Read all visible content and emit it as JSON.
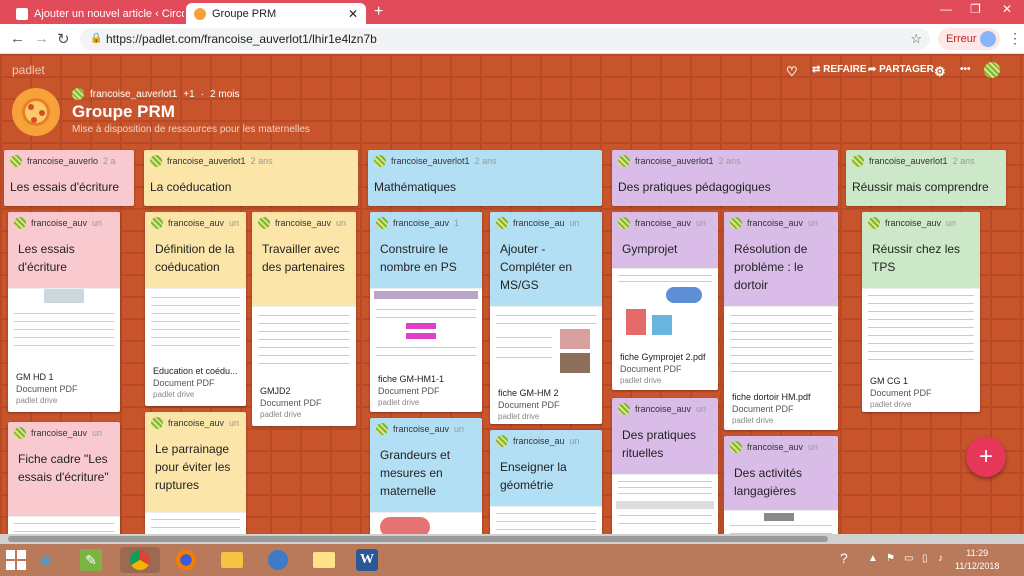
{
  "browser": {
    "tabs": [
      {
        "title": "Ajouter un nouvel article ‹ Circon",
        "active": false
      },
      {
        "title": "Groupe PRM",
        "active": true
      }
    ],
    "new_tab": "+",
    "url": "https://padlet.com/francoise_auverlot1/lhir1e4lzn7b",
    "error_label": "Erreur",
    "window_controls": {
      "minimize": "—",
      "restore": "❐",
      "close": "✕"
    }
  },
  "padlet": {
    "logo": "padlet",
    "actions": {
      "remake": "REFAIRE",
      "share": "PARTAGER"
    },
    "icons": [
      "heart-icon",
      "remake-icon",
      "share-icon",
      "settings-icon",
      "more-icon"
    ],
    "author": "francoise_auverlot1",
    "plus": "+1",
    "dot": "·",
    "age": "2 mois",
    "title": "Groupe PRM",
    "subtitle": "Mise à disposition de ressources pour les maternelles"
  },
  "columns": [
    {
      "author": "francoise_auverlo",
      "ago": "2 a",
      "title": "Les essais d'écriture",
      "color": "#f8c9cf"
    },
    {
      "author": "francoise_auverlot1",
      "ago": "2 ans",
      "title": "La coéducation",
      "color": "#fbe5a8"
    },
    {
      "author": "francoise_auverlot1",
      "ago": "2 ans",
      "title": "Mathématiques",
      "color": "#b3dff5"
    },
    {
      "author": "francoise_auverlot1",
      "ago": "2 ans",
      "title": "Des pratiques pédagogiques",
      "color": "#d9bde8"
    },
    {
      "author": "francoise_auverlot1",
      "ago": "2 ans",
      "title": "Réussir mais comprendre",
      "color": "#cce8c8"
    }
  ],
  "cards": {
    "c1": {
      "author": "francoise_auv",
      "ago": "un",
      "title": "Les essais d'écriture",
      "file": "GM HD 1",
      "type": "Document PDF",
      "source": "padlet drive"
    },
    "c2": {
      "author": "francoise_auv",
      "ago": "un",
      "title": "Fiche cadre \"Les essais d'écriture\""
    },
    "c3": {
      "author": "francoise_auv",
      "ago": "un",
      "title": "Définition de la coéducation",
      "file": "Education et coédu...",
      "type": "Document PDF",
      "source": "padlet drive"
    },
    "c4": {
      "author": "francoise_auv",
      "ago": "un",
      "title": "Travailler avec des partenaires",
      "file": "GMJD2",
      "type": "Document PDF",
      "source": "padlet drive"
    },
    "c5": {
      "author": "francoise_auv",
      "ago": "un",
      "title": "Le parrainage pour éviter les ruptures"
    },
    "c6": {
      "author": "francoise_auv",
      "ago": "1",
      "title": "Construire le nombre en PS",
      "file": "fiche GM-HM1-1",
      "type": "Document PDF",
      "source": "padlet drive"
    },
    "c7": {
      "author": "francoise_au",
      "ago": "un",
      "title": "Ajouter - Compléter en MS/GS",
      "file": "fiche GM-HM 2",
      "type": "Document PDF",
      "source": "padlet drive"
    },
    "c8": {
      "author": "francoise_auv",
      "ago": "un",
      "title": "Grandeurs et mesures en maternelle"
    },
    "c9": {
      "author": "francoise_au",
      "ago": "un",
      "title": "Enseigner la géométrie"
    },
    "c10": {
      "author": "francoise_auv",
      "ago": "un",
      "title": "Gymprojet",
      "file": "fiche Gymprojet 2.pdf",
      "type": "Document PDF",
      "source": "padlet drive"
    },
    "c11": {
      "author": "francoise_auv",
      "ago": "un",
      "title": "Résolution de problème : le dortoir",
      "file": "fiche dortoir HM.pdf",
      "type": "Document PDF",
      "source": "padlet drive"
    },
    "c12": {
      "author": "francoise_auv",
      "ago": "un",
      "title": "Des pratiques rituelles"
    },
    "c13": {
      "author": "francoise_auv",
      "ago": "un",
      "title": "Des activités langagières"
    },
    "c14": {
      "author": "francoise_auv",
      "ago": "un",
      "title": "Réussir chez les TPS",
      "file": "GM CG 1",
      "type": "Document PDF",
      "source": "padlet drive"
    }
  },
  "fab": "+",
  "taskbar": {
    "apps": [
      "ie-icon",
      "notepad-icon",
      "chrome-icon",
      "firefox-icon",
      "explorer-icon",
      "thunderbird-icon",
      "folder-icon",
      "word-icon"
    ],
    "time": "11:29",
    "date": "11/12/2018"
  }
}
